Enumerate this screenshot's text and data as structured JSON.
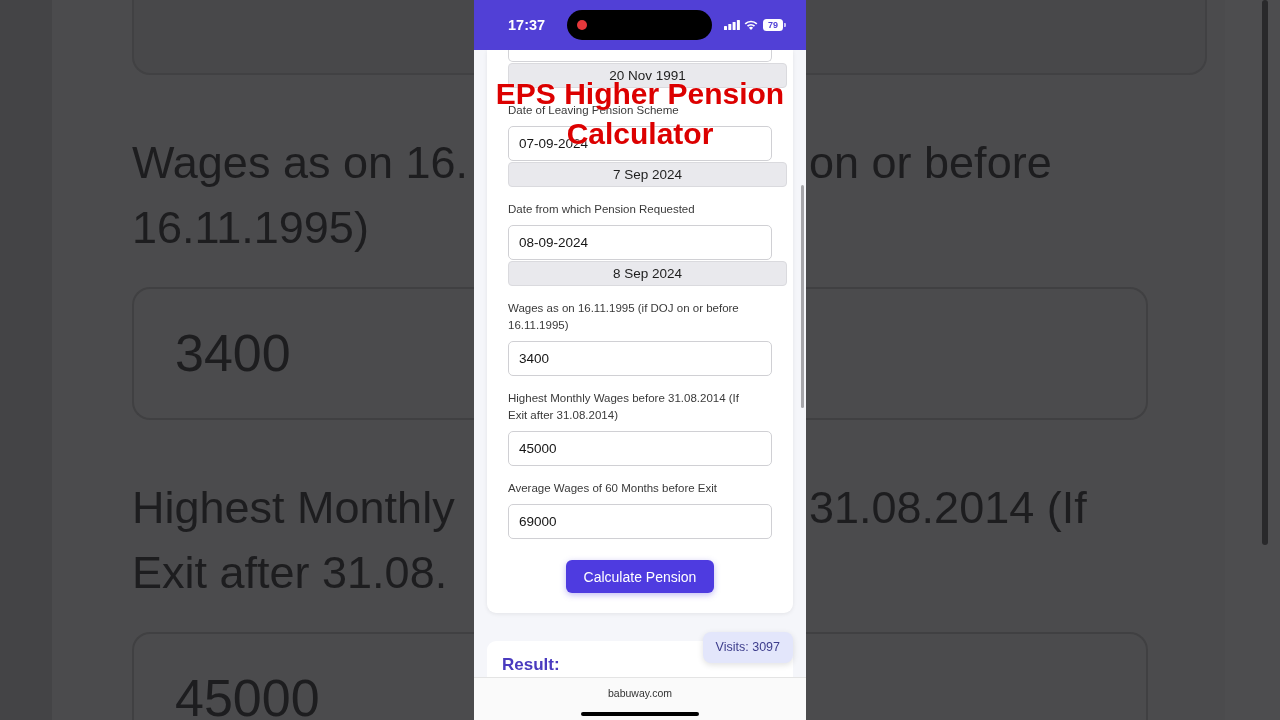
{
  "backdrop": [
    {
      "kind": "display"
    },
    {
      "kind": "label",
      "left": "Wages as on 16.",
      "right": "on or before"
    },
    {
      "kind": "label",
      "left": "16.11.1995)"
    },
    {
      "kind": "field",
      "value": "3400"
    },
    {
      "kind": "label",
      "left": "Highest Monthly",
      "right": "31.08.2014 (If"
    },
    {
      "kind": "label",
      "left": "Exit after 31.08."
    },
    {
      "kind": "field",
      "value": "45000"
    }
  ],
  "status_bar": {
    "time": "17:37",
    "recording": true,
    "battery": "79"
  },
  "form": {
    "cut_off_field": {
      "display": "20 Nov 1991"
    },
    "fields": [
      {
        "label": "Date of Leaving Pension Scheme",
        "value": "07-09-2024",
        "display": "7 Sep 2024"
      },
      {
        "label": "Date from which Pension Requested",
        "value": "08-09-2024",
        "display": "8 Sep 2024"
      },
      {
        "label": "Wages as on 16.11.1995 (if DOJ on or before 16.11.1995)",
        "value": "3400"
      },
      {
        "label": "Highest Monthly Wages before 31.08.2014 (If Exit after 31.08.2014)",
        "value": "45000"
      },
      {
        "label": "Average Wages of 60 Months before Exit",
        "value": "69000"
      }
    ],
    "button": "Calculate Pension"
  },
  "result": {
    "title": "Result:"
  },
  "visits_badge": "Visits: 3097",
  "caption": {
    "lines": [
      "EPS Higher Pension",
      "Calculator"
    ]
  },
  "address_bar": {
    "url": "babuway.com"
  }
}
